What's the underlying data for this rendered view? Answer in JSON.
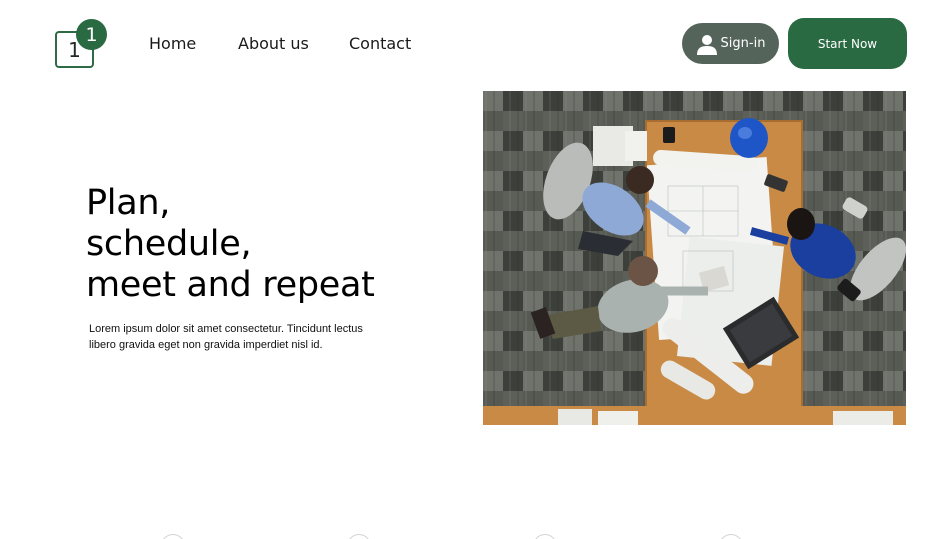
{
  "logo": {
    "box_text": "1",
    "badge_text": "1"
  },
  "nav": {
    "items": [
      {
        "label": "Home"
      },
      {
        "label": "About us"
      },
      {
        "label": "Contact"
      }
    ]
  },
  "actions": {
    "signin_label": "Sign-in",
    "start_label": "Start Now"
  },
  "hero": {
    "title_lines": [
      "Plan,",
      "schedule,",
      "meet and repeat"
    ],
    "description": "Lorem ipsum dolor sit amet consectetur. Tincidunt lectus libero gravida eget non gravida imperdiet nisl id."
  },
  "colors": {
    "brand_green": "#2a6a43",
    "signin_gray": "#55645a"
  },
  "icons": {
    "signin": "user-icon"
  }
}
